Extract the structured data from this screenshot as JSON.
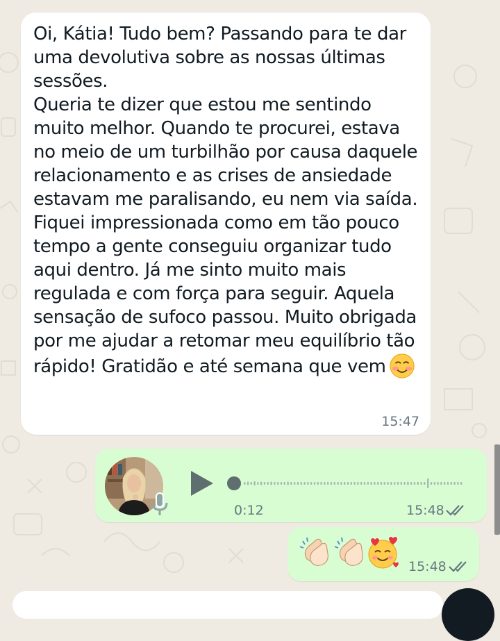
{
  "chat": {
    "incoming": {
      "paragraphs": [
        "Oi, Kátia! Tudo bem? Passando para te dar uma devolutiva sobre as nossas últimas sessões.",
        "Queria te dizer que estou me sentindo muito melhor. Quando te procurei, estava no meio de um turbilhão por causa daquele relacionamento e as crises de ansiedade estavam me paralisando, eu nem via saída.",
        "Fiquei impressionada como em tão pouco tempo a gente conseguiu organizar tudo aqui dentro. Já me sinto muito mais regulada e com força para seguir. Aquela sensação de sufoco passou. Muito obrigada por me ajudar a retomar meu equilíbrio tão rápido! Gratidão e até semana que vem"
      ],
      "trailing_emoji": "smiling-face-with-blush",
      "time": "15:47"
    },
    "voice_note": {
      "duration": "0:12",
      "time": "15:48",
      "progress": 0.0,
      "status": "read"
    },
    "emoji_message": {
      "emojis": [
        "clapping-hands",
        "clapping-hands",
        "smiling-face-with-hearts"
      ],
      "time": "15:48",
      "status": "read"
    }
  },
  "colors": {
    "wallpaper": "#efeae2",
    "incoming_bubble": "#ffffff",
    "outgoing_bubble": "#d9fdd3",
    "meta_text": "#667781",
    "text": "#111b21"
  }
}
